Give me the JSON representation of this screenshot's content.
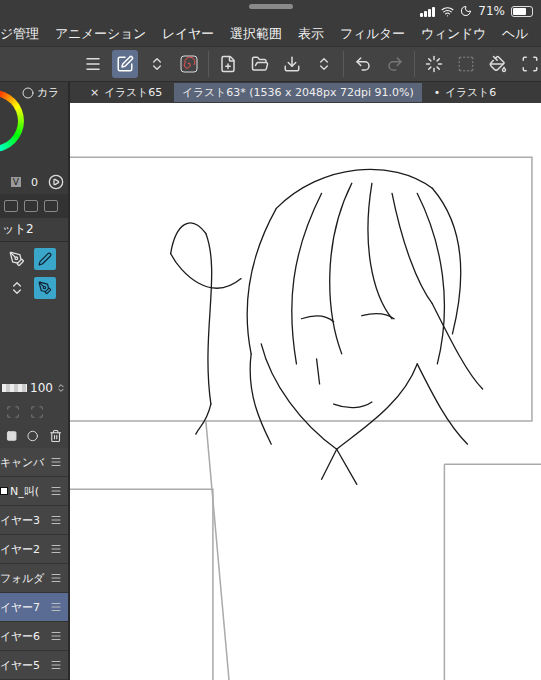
{
  "status_bar": {
    "battery": "71%",
    "battery_level": 0.71
  },
  "menu": [
    "ジ管理",
    "アニメーション",
    "レイヤー",
    "選択範囲",
    "表示",
    "フィルター",
    "ウィンドウ",
    "ヘル"
  ],
  "tabs": [
    {
      "label": "イラスト65",
      "prefix": "×",
      "selected": false
    },
    {
      "label": "イラスト63* (1536 x 2048px 72dpi 91.0%)",
      "prefix": "",
      "selected": true
    },
    {
      "label": "イラスト6",
      "prefix": "•",
      "selected": false
    }
  ],
  "color_panel": {
    "tab": "カラ",
    "channel": "V",
    "value": "0"
  },
  "subtool": {
    "label": "ット2"
  },
  "layer_opacity": {
    "value": "100",
    "level": 1
  },
  "layers": [
    {
      "name": "キャンバ",
      "selected": false,
      "thumbnail": false
    },
    {
      "name": "N_叫(",
      "selected": false,
      "thumbnail": true
    },
    {
      "name": "イヤー3",
      "selected": false,
      "thumbnail": false
    },
    {
      "name": "イヤー2",
      "selected": false,
      "thumbnail": false
    },
    {
      "name": "フォルダ",
      "selected": false,
      "thumbnail": false
    },
    {
      "name": "イヤー7",
      "selected": true,
      "thumbnail": false
    },
    {
      "name": "イヤー6",
      "selected": false,
      "thumbnail": false
    },
    {
      "name": "イヤー5",
      "selected": false,
      "thumbnail": false
    }
  ]
}
